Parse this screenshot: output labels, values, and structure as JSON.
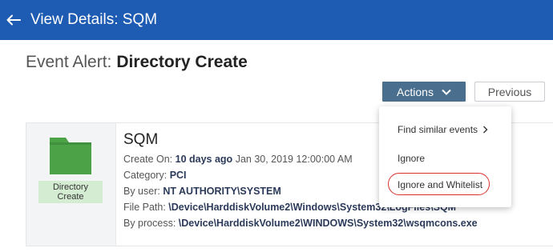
{
  "header": {
    "title": "View Details: SQM",
    "back_icon": "arrow-left-icon"
  },
  "alert": {
    "label": "Event Alert:",
    "value": "Directory Create"
  },
  "toolbar": {
    "actions_label": "Actions",
    "previous_label": "Previous"
  },
  "event": {
    "icon": "folder-icon",
    "icon_label_line1": "Directory",
    "icon_label_line2": "Create",
    "name": "SQM",
    "create_on_label": "Create On:",
    "create_on_relative": "10 days ago",
    "create_on_date": "Jan 30, 2019 12:00:00 AM",
    "category_label": "Category:",
    "category_value": "PCI",
    "user_label": "By user:",
    "user_value": "NT AUTHORITY\\SYSTEM",
    "file_path_label": "File Path:",
    "file_path_value": "\\Device\\HarddiskVolume2\\Windows\\System32\\LogFiles\\SQM",
    "process_label": "By process:",
    "process_value": "\\Device\\HarddiskVolume2\\WINDOWS\\System32\\wsqmcons.exe"
  },
  "actions_menu": {
    "items": [
      "Find similar events",
      "Ignore",
      "Ignore and Whitelist"
    ],
    "highlighted": "Ignore and Whitelist"
  },
  "colors": {
    "header": "#1e5cb3",
    "actions_button": "#4a6f8e",
    "folder": "#4ca347",
    "highlight": "#d9322e"
  }
}
